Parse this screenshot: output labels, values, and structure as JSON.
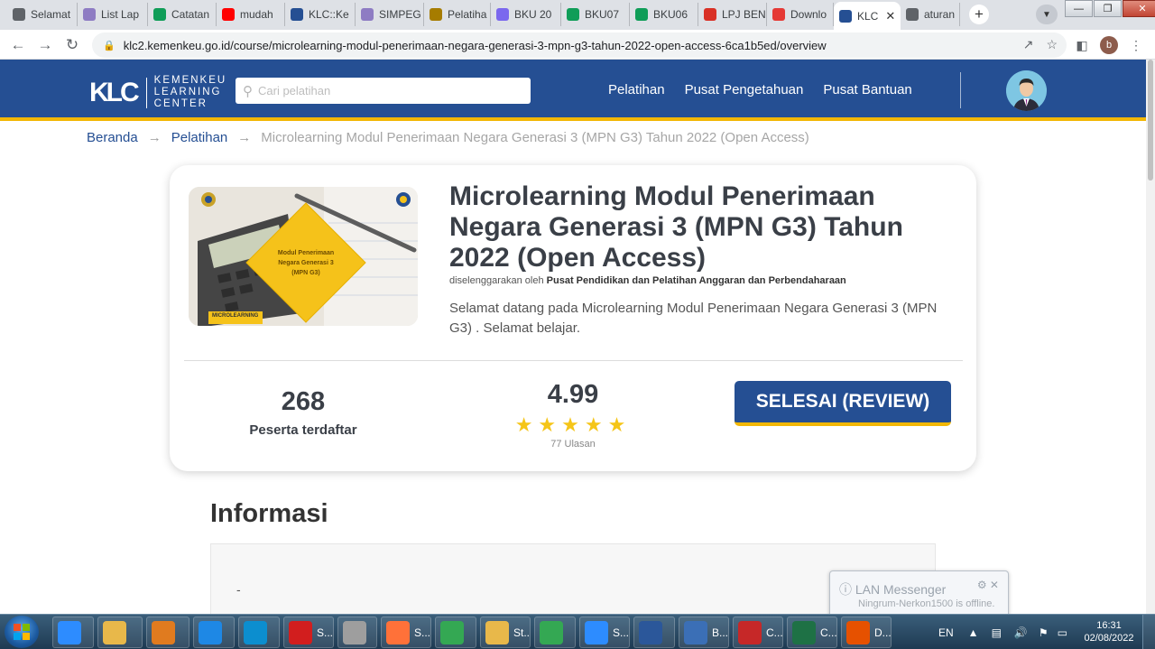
{
  "browser": {
    "tabs": [
      {
        "label": "Selamat",
        "icon": "chrome-icon",
        "color": "#5f6368"
      },
      {
        "label": "List Lap",
        "icon": "pinwheel-icon",
        "color": "#8e7cc3"
      },
      {
        "label": "Catatan",
        "icon": "sheets-icon",
        "color": "#0f9d58"
      },
      {
        "label": "mudah",
        "icon": "youtube-icon",
        "color": "#ff0000"
      },
      {
        "label": "KLC::Ke",
        "icon": "klc-icon",
        "color": "#254f93"
      },
      {
        "label": "SIMPEG",
        "icon": "pinwheel-icon",
        "color": "#8e7cc3"
      },
      {
        "label": "Pelatiha",
        "icon": "emblem-icon",
        "color": "#a67c00"
      },
      {
        "label": "BKU 20",
        "icon": "people-icon",
        "color": "#7b68ee"
      },
      {
        "label": "BKU07",
        "icon": "sheets-icon",
        "color": "#0f9d58"
      },
      {
        "label": "BKU06",
        "icon": "sheets-icon",
        "color": "#0f9d58"
      },
      {
        "label": "LPJ BEN",
        "icon": "gmail-icon",
        "color": "#d93025"
      },
      {
        "label": "Downlo",
        "icon": "heart-icon",
        "color": "#e53935"
      },
      {
        "label": "KLC",
        "icon": "klc-icon",
        "color": "#254f93",
        "active": true
      },
      {
        "label": "aturan",
        "icon": "chrome-icon",
        "color": "#5f6368"
      }
    ],
    "url": "klc2.kemenkeu.go.id/course/microlearning-modul-penerimaan-negara-generasi-3-mpn-g3-tahun-2022-open-access-6ca1b5ed/overview",
    "profile_initial": "b"
  },
  "site": {
    "logo_mark": "KLC",
    "logo_lines": [
      "KEMENKEU",
      "LEARNING",
      "CENTER"
    ],
    "search_placeholder": "Cari pelatihan",
    "nav": [
      "Pelatihan",
      "Pusat Pengetahuan",
      "Pusat Bantuan"
    ],
    "colors": {
      "primary": "#254f93",
      "accent": "#f2b705"
    }
  },
  "breadcrumb": {
    "items": [
      "Beranda",
      "Pelatihan"
    ],
    "current": "Microlearning Modul Penerimaan Negara Generasi 3 (MPN G3) Tahun 2022 (Open Access)"
  },
  "course": {
    "title": "Microlearning Modul Penerimaan Negara Generasi 3 (MPN G3) Tahun 2022 (Open Access)",
    "organizer_prefix": "diselenggarakan oleh",
    "organizer": "Pusat Pendidikan dan Pelatihan Anggaran dan Perbendaharaan",
    "description": "Selamat datang pada Microlearning Modul Penerimaan Negara Generasi 3 (MPN G3) . Selamat belajar.",
    "thumbnail": {
      "line1": "Modul Penerimaan",
      "line2": "Negara Generasi 3",
      "line3": "(MPN G3)",
      "tag": "MICROLEARNING"
    },
    "participants": "268",
    "participants_label": "Peserta terdaftar",
    "rating": "4.99",
    "stars": 5,
    "reviews": "77 Ulasan",
    "cta": "SELESAI (REVIEW)"
  },
  "info": {
    "heading": "Informasi",
    "value": "-"
  },
  "notification": {
    "title": "LAN Messenger",
    "message": "Ningrum-Nerkon1500 is offline."
  },
  "taskbar": {
    "items": [
      {
        "label": "",
        "icon": "zoom-icon",
        "color": "#2d8cff"
      },
      {
        "label": "",
        "icon": "folder-icon",
        "color": "#e8b84a"
      },
      {
        "label": "",
        "icon": "media-icon",
        "color": "#e07b1f"
      },
      {
        "label": "",
        "icon": "ie-icon",
        "color": "#1e88e5"
      },
      {
        "label": "",
        "icon": "edge-icon",
        "color": "#0c8ecf"
      },
      {
        "label": "S...",
        "icon": "opera-icon",
        "color": "#d21e1e"
      },
      {
        "label": "",
        "icon": "notepad-icon",
        "color": "#9e9e9e"
      },
      {
        "label": "S...",
        "icon": "firefox-icon",
        "color": "#ff7139"
      },
      {
        "label": "",
        "icon": "chrome-icon",
        "color": "#34a853"
      },
      {
        "label": "St...",
        "icon": "folder-icon",
        "color": "#e8b84a"
      },
      {
        "label": "",
        "icon": "chrome-icon",
        "color": "#34a853"
      },
      {
        "label": "S...",
        "icon": "zoom-icon",
        "color": "#2d8cff"
      },
      {
        "label": "",
        "icon": "word-icon",
        "color": "#2b579a"
      },
      {
        "label": "B...",
        "icon": "app-icon",
        "color": "#3b6fb6"
      },
      {
        "label": "C...",
        "icon": "cc4-icon",
        "color": "#c62828"
      },
      {
        "label": "C...",
        "icon": "excel-icon",
        "color": "#1e7145"
      },
      {
        "label": "D...",
        "icon": "pdf-icon",
        "color": "#e65100"
      }
    ],
    "language": "EN",
    "time": "16:31",
    "date": "02/08/2022"
  }
}
